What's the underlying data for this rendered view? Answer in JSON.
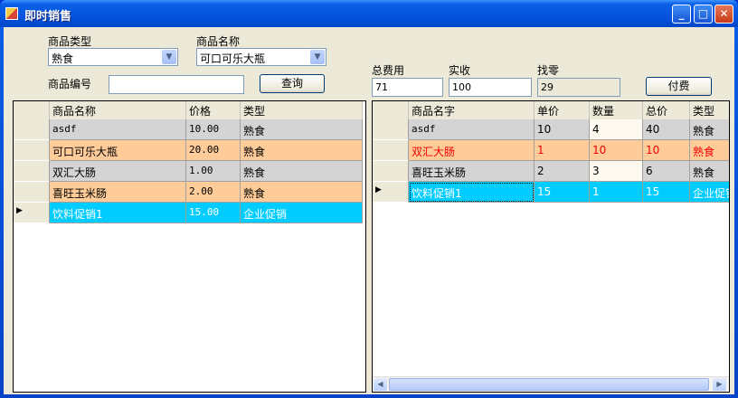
{
  "window": {
    "title": "即时销售"
  },
  "filters": {
    "category_label": "商品类型",
    "category_value": "熟食",
    "name_label": "商品名称",
    "name_value": "可口可乐大瓶",
    "code_label": "商品编号",
    "code_value": "",
    "query_button": "查询"
  },
  "payment": {
    "total_label": "总费用",
    "total_value": "71",
    "received_label": "实收",
    "received_value": "100",
    "change_label": "找零",
    "change_value": "29",
    "pay_button": "付费"
  },
  "products_grid": {
    "columns": [
      "商品名称",
      "价格",
      "类型"
    ],
    "rows": [
      [
        "asdf",
        "10.00",
        "熟食"
      ],
      [
        "可口可乐大瓶",
        "20.00",
        "熟食"
      ],
      [
        "双汇大肠",
        "1.00",
        "熟食"
      ],
      [
        "喜旺玉米肠",
        "2.00",
        "熟食"
      ],
      [
        "饮料促销1",
        "15.00",
        "企业促销"
      ]
    ]
  },
  "cart_grid": {
    "columns": [
      "商品名字",
      "单价",
      "数量",
      "总价",
      "类型"
    ],
    "rows": [
      [
        "asdf",
        "10",
        "4",
        "40",
        "熟食"
      ],
      [
        "双汇大肠",
        "1",
        "10",
        "10",
        "熟食"
      ],
      [
        "喜旺玉米肠",
        "2",
        "3",
        "6",
        "熟食"
      ],
      [
        "饮料促销1",
        "15",
        "1",
        "15",
        "企业促销"
      ]
    ]
  },
  "colors": {
    "row_gray": "#d4d4d4",
    "row_orange": "#ffcc99",
    "row_selected": "#00ccff",
    "row_red_text": "#ee0000"
  }
}
